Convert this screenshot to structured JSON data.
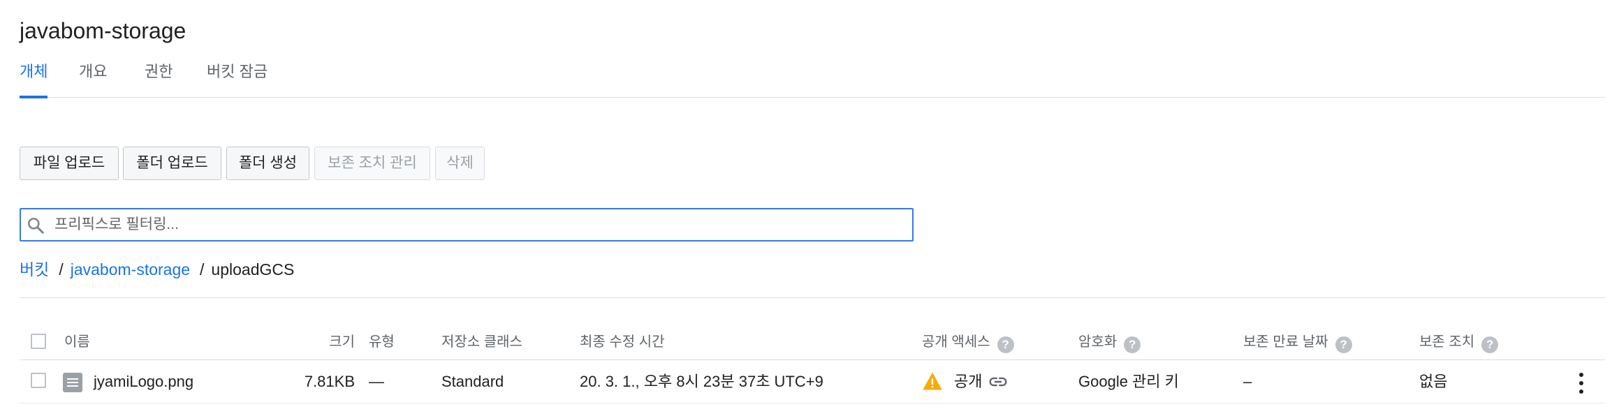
{
  "bucket_title": "javabom-storage",
  "tabs": [
    {
      "label": "개체",
      "active": true
    },
    {
      "label": "개요",
      "active": false
    },
    {
      "label": "권한",
      "active": false
    },
    {
      "label": "버킷 잠금",
      "active": false
    }
  ],
  "toolbar": {
    "upload_file": "파일 업로드",
    "upload_folder": "폴더 업로드",
    "create_folder": "폴더 생성",
    "manage_retention": "보존 조치 관리",
    "delete": "삭제"
  },
  "filter": {
    "placeholder": "프리픽스로 필터링..."
  },
  "breadcrumb": {
    "root": "버킷",
    "bucket": "javabom-storage",
    "folder": "uploadGCS",
    "separator": "/"
  },
  "table": {
    "headers": {
      "name": "이름",
      "size": "크기",
      "type": "유형",
      "storage_class": "저장소 클래스",
      "modified": "최종 수정 시간",
      "public_access": "공개 액세스",
      "encryption": "암호화",
      "retention_expiry": "보존 만료 날짜",
      "hold": "보존 조치"
    },
    "help_glyph": "?",
    "rows": [
      {
        "name": "jyamiLogo.png",
        "size": "7.81KB",
        "type": "—",
        "storage_class": "Standard",
        "modified": "20. 3. 1., 오후 8시 23분 37초 UTC+9",
        "public_access": "공개",
        "encryption": "Google 관리 키",
        "retention_expiry": "–",
        "hold": "없음"
      }
    ]
  },
  "icons": {
    "search": "search-icon",
    "file": "file-icon",
    "warning": "warning-icon",
    "link": "link-icon",
    "more": "more-vert-icon",
    "help": "help-icon"
  },
  "colors": {
    "accent": "#1a73e8",
    "warning": "#f9ab00"
  }
}
